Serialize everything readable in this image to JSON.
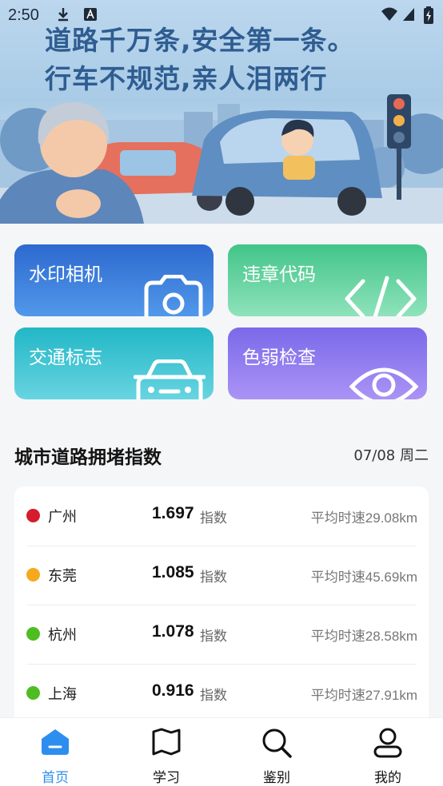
{
  "status_bar": {
    "time": "2:50"
  },
  "banner": {
    "slogan_line1": "道路千万条,安全第一条。",
    "slogan_line2": "行车不规范,亲人泪两行"
  },
  "features": [
    {
      "label": "水印相机",
      "icon": "camera-icon",
      "gradient": [
        "#2d69cf",
        "#5198ea"
      ]
    },
    {
      "label": "违章代码",
      "icon": "code-icon",
      "gradient": [
        "#42c489",
        "#8fe3bb"
      ]
    },
    {
      "label": "交通标志",
      "icon": "car-icon",
      "gradient": [
        "#22b7c6",
        "#68d4e1"
      ]
    },
    {
      "label": "色弱检查",
      "icon": "eye-icon",
      "gradient": [
        "#7a69ea",
        "#ab93f5"
      ]
    }
  ],
  "congestion": {
    "title": "城市道路拥堵指数",
    "date": "07/08 周二",
    "unit_label": "指数",
    "speed_prefix": "平均时速",
    "rows": [
      {
        "city": "广州",
        "index": "1.697",
        "speed": "29.08km",
        "color": "#d41c2c"
      },
      {
        "city": "东莞",
        "index": "1.085",
        "speed": "45.69km",
        "color": "#f5a91e"
      },
      {
        "city": "杭州",
        "index": "1.078",
        "speed": "28.58km",
        "color": "#4ebd22"
      },
      {
        "city": "上海",
        "index": "0.916",
        "speed": "27.91km",
        "color": "#4ebd22"
      }
    ]
  },
  "bottom_nav": {
    "active_color": "#2e8ef0",
    "items": [
      {
        "label": "首页",
        "icon": "home-icon",
        "active": true
      },
      {
        "label": "学习",
        "icon": "book-icon",
        "active": false
      },
      {
        "label": "鉴别",
        "icon": "search-icon",
        "active": false
      },
      {
        "label": "我的",
        "icon": "user-icon",
        "active": false
      }
    ]
  }
}
